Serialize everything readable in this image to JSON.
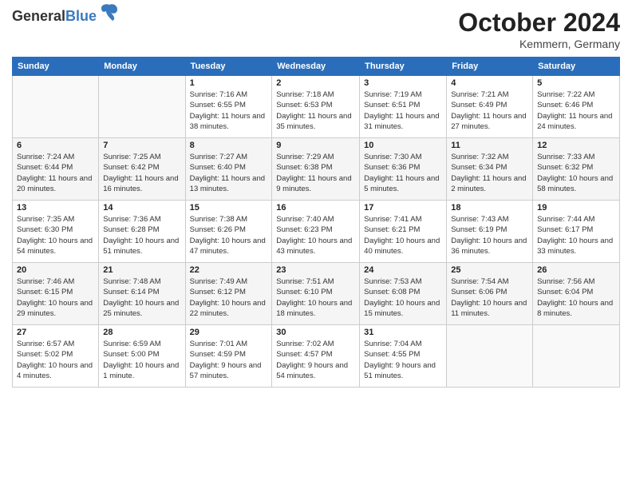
{
  "header": {
    "logo_general": "General",
    "logo_blue": "Blue",
    "month_title": "October 2024",
    "location": "Kemmern, Germany"
  },
  "weekdays": [
    "Sunday",
    "Monday",
    "Tuesday",
    "Wednesday",
    "Thursday",
    "Friday",
    "Saturday"
  ],
  "weeks": [
    [
      {
        "day": "",
        "sunrise": "",
        "sunset": "",
        "daylight": ""
      },
      {
        "day": "",
        "sunrise": "",
        "sunset": "",
        "daylight": ""
      },
      {
        "day": "1",
        "sunrise": "Sunrise: 7:16 AM",
        "sunset": "Sunset: 6:55 PM",
        "daylight": "Daylight: 11 hours and 38 minutes."
      },
      {
        "day": "2",
        "sunrise": "Sunrise: 7:18 AM",
        "sunset": "Sunset: 6:53 PM",
        "daylight": "Daylight: 11 hours and 35 minutes."
      },
      {
        "day": "3",
        "sunrise": "Sunrise: 7:19 AM",
        "sunset": "Sunset: 6:51 PM",
        "daylight": "Daylight: 11 hours and 31 minutes."
      },
      {
        "day": "4",
        "sunrise": "Sunrise: 7:21 AM",
        "sunset": "Sunset: 6:49 PM",
        "daylight": "Daylight: 11 hours and 27 minutes."
      },
      {
        "day": "5",
        "sunrise": "Sunrise: 7:22 AM",
        "sunset": "Sunset: 6:46 PM",
        "daylight": "Daylight: 11 hours and 24 minutes."
      }
    ],
    [
      {
        "day": "6",
        "sunrise": "Sunrise: 7:24 AM",
        "sunset": "Sunset: 6:44 PM",
        "daylight": "Daylight: 11 hours and 20 minutes."
      },
      {
        "day": "7",
        "sunrise": "Sunrise: 7:25 AM",
        "sunset": "Sunset: 6:42 PM",
        "daylight": "Daylight: 11 hours and 16 minutes."
      },
      {
        "day": "8",
        "sunrise": "Sunrise: 7:27 AM",
        "sunset": "Sunset: 6:40 PM",
        "daylight": "Daylight: 11 hours and 13 minutes."
      },
      {
        "day": "9",
        "sunrise": "Sunrise: 7:29 AM",
        "sunset": "Sunset: 6:38 PM",
        "daylight": "Daylight: 11 hours and 9 minutes."
      },
      {
        "day": "10",
        "sunrise": "Sunrise: 7:30 AM",
        "sunset": "Sunset: 6:36 PM",
        "daylight": "Daylight: 11 hours and 5 minutes."
      },
      {
        "day": "11",
        "sunrise": "Sunrise: 7:32 AM",
        "sunset": "Sunset: 6:34 PM",
        "daylight": "Daylight: 11 hours and 2 minutes."
      },
      {
        "day": "12",
        "sunrise": "Sunrise: 7:33 AM",
        "sunset": "Sunset: 6:32 PM",
        "daylight": "Daylight: 10 hours and 58 minutes."
      }
    ],
    [
      {
        "day": "13",
        "sunrise": "Sunrise: 7:35 AM",
        "sunset": "Sunset: 6:30 PM",
        "daylight": "Daylight: 10 hours and 54 minutes."
      },
      {
        "day": "14",
        "sunrise": "Sunrise: 7:36 AM",
        "sunset": "Sunset: 6:28 PM",
        "daylight": "Daylight: 10 hours and 51 minutes."
      },
      {
        "day": "15",
        "sunrise": "Sunrise: 7:38 AM",
        "sunset": "Sunset: 6:26 PM",
        "daylight": "Daylight: 10 hours and 47 minutes."
      },
      {
        "day": "16",
        "sunrise": "Sunrise: 7:40 AM",
        "sunset": "Sunset: 6:23 PM",
        "daylight": "Daylight: 10 hours and 43 minutes."
      },
      {
        "day": "17",
        "sunrise": "Sunrise: 7:41 AM",
        "sunset": "Sunset: 6:21 PM",
        "daylight": "Daylight: 10 hours and 40 minutes."
      },
      {
        "day": "18",
        "sunrise": "Sunrise: 7:43 AM",
        "sunset": "Sunset: 6:19 PM",
        "daylight": "Daylight: 10 hours and 36 minutes."
      },
      {
        "day": "19",
        "sunrise": "Sunrise: 7:44 AM",
        "sunset": "Sunset: 6:17 PM",
        "daylight": "Daylight: 10 hours and 33 minutes."
      }
    ],
    [
      {
        "day": "20",
        "sunrise": "Sunrise: 7:46 AM",
        "sunset": "Sunset: 6:15 PM",
        "daylight": "Daylight: 10 hours and 29 minutes."
      },
      {
        "day": "21",
        "sunrise": "Sunrise: 7:48 AM",
        "sunset": "Sunset: 6:14 PM",
        "daylight": "Daylight: 10 hours and 25 minutes."
      },
      {
        "day": "22",
        "sunrise": "Sunrise: 7:49 AM",
        "sunset": "Sunset: 6:12 PM",
        "daylight": "Daylight: 10 hours and 22 minutes."
      },
      {
        "day": "23",
        "sunrise": "Sunrise: 7:51 AM",
        "sunset": "Sunset: 6:10 PM",
        "daylight": "Daylight: 10 hours and 18 minutes."
      },
      {
        "day": "24",
        "sunrise": "Sunrise: 7:53 AM",
        "sunset": "Sunset: 6:08 PM",
        "daylight": "Daylight: 10 hours and 15 minutes."
      },
      {
        "day": "25",
        "sunrise": "Sunrise: 7:54 AM",
        "sunset": "Sunset: 6:06 PM",
        "daylight": "Daylight: 10 hours and 11 minutes."
      },
      {
        "day": "26",
        "sunrise": "Sunrise: 7:56 AM",
        "sunset": "Sunset: 6:04 PM",
        "daylight": "Daylight: 10 hours and 8 minutes."
      }
    ],
    [
      {
        "day": "27",
        "sunrise": "Sunrise: 6:57 AM",
        "sunset": "Sunset: 5:02 PM",
        "daylight": "Daylight: 10 hours and 4 minutes."
      },
      {
        "day": "28",
        "sunrise": "Sunrise: 6:59 AM",
        "sunset": "Sunset: 5:00 PM",
        "daylight": "Daylight: 10 hours and 1 minute."
      },
      {
        "day": "29",
        "sunrise": "Sunrise: 7:01 AM",
        "sunset": "Sunset: 4:59 PM",
        "daylight": "Daylight: 9 hours and 57 minutes."
      },
      {
        "day": "30",
        "sunrise": "Sunrise: 7:02 AM",
        "sunset": "Sunset: 4:57 PM",
        "daylight": "Daylight: 9 hours and 54 minutes."
      },
      {
        "day": "31",
        "sunrise": "Sunrise: 7:04 AM",
        "sunset": "Sunset: 4:55 PM",
        "daylight": "Daylight: 9 hours and 51 minutes."
      },
      {
        "day": "",
        "sunrise": "",
        "sunset": "",
        "daylight": ""
      },
      {
        "day": "",
        "sunrise": "",
        "sunset": "",
        "daylight": ""
      }
    ]
  ]
}
